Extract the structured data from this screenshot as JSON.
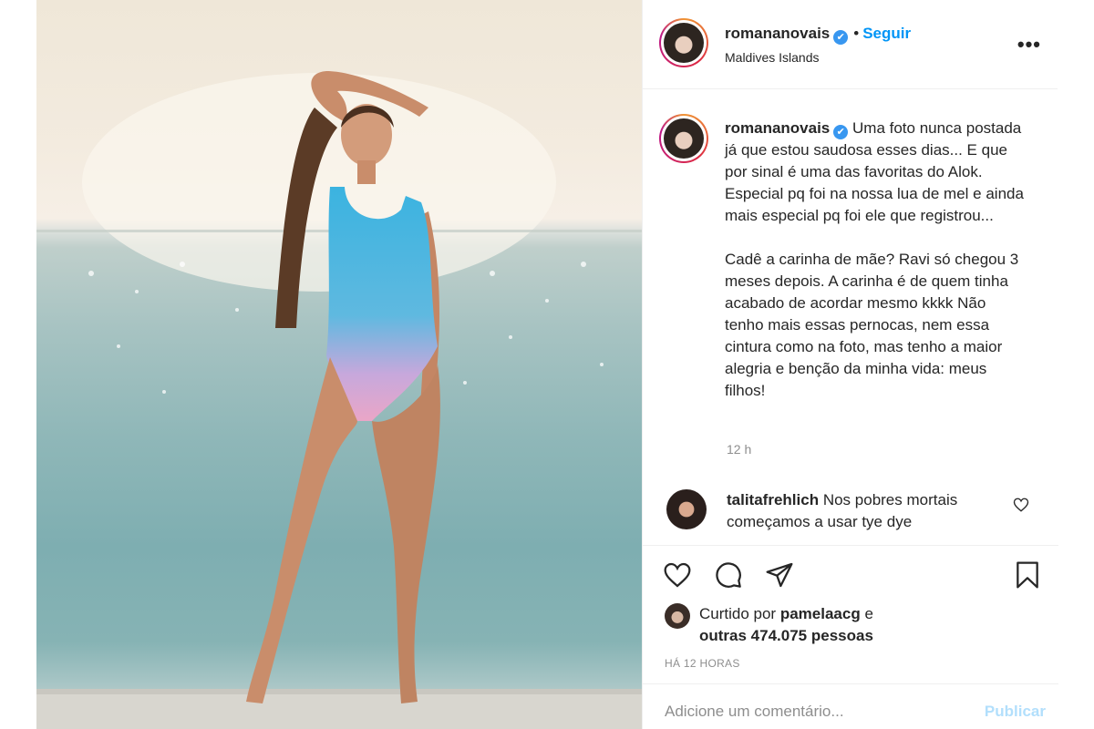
{
  "post": {
    "username": "romananovais",
    "verified_badge": "✔",
    "follow_separator": "•",
    "follow_label": "Seguir",
    "location": "Maldives Islands",
    "more_icon": "•••"
  },
  "caption": {
    "username": "romananovais",
    "text": "Uma foto nunca postada já que estou saudosa esses dias... E que por sinal é uma das favoritas do Alok. Especial pq foi na nossa lua de mel e ainda mais especial pq foi ele que registrou...\n\nCadê a carinha de mãe? Ravi só chegou 3 meses depois. A carinha é de quem tinha acabado de acordar mesmo kkkk Não tenho mais essas pernocas, nem essa cintura como na foto, mas tenho a maior alegria e benção da minha vida: meus filhos!",
    "time_ago": "12 h"
  },
  "comments": [
    {
      "username": "talitafrehlich",
      "text": "Nos pobres mortais começamos a usar tye dye"
    }
  ],
  "likes": {
    "prefix": "Curtido por",
    "liker": "pamelaacg",
    "joiner": "e",
    "others": "outras 474.075 pessoas"
  },
  "post_time": "HÁ 12 HORAS",
  "comment_input": {
    "placeholder": "Adicione um comentário...",
    "publish_label": "Publicar"
  },
  "icons": {
    "like": "heart-icon",
    "comment": "comment-icon",
    "share": "send-icon",
    "save": "bookmark-icon"
  },
  "colors": {
    "link_blue": "#0095f6",
    "publish_disabled": "#b2dffc",
    "secondary_text": "#8e8e8e",
    "verified_blue": "#3897f0"
  }
}
